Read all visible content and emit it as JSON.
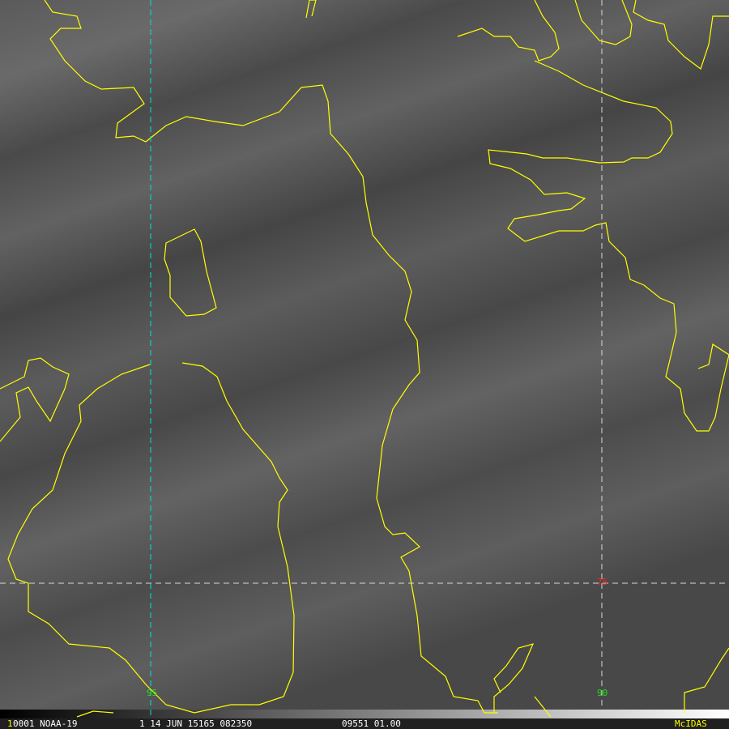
{
  "image": {
    "frame_number": "1",
    "info_left": "0001 NOAA-19",
    "info_mid": "1 14 JUN 15165 082350",
    "info_right": "09551 01.00",
    "brand": "McIDAS"
  },
  "grid_labels": {
    "lon_95": "95",
    "lon_90": "90",
    "lat_75": "75"
  },
  "colors": {
    "coastline": "#ffff00",
    "gridline": "#00e0e0",
    "lat_label": "#ff2020",
    "lon_label": "#20e020",
    "brand": "#ffff00"
  }
}
